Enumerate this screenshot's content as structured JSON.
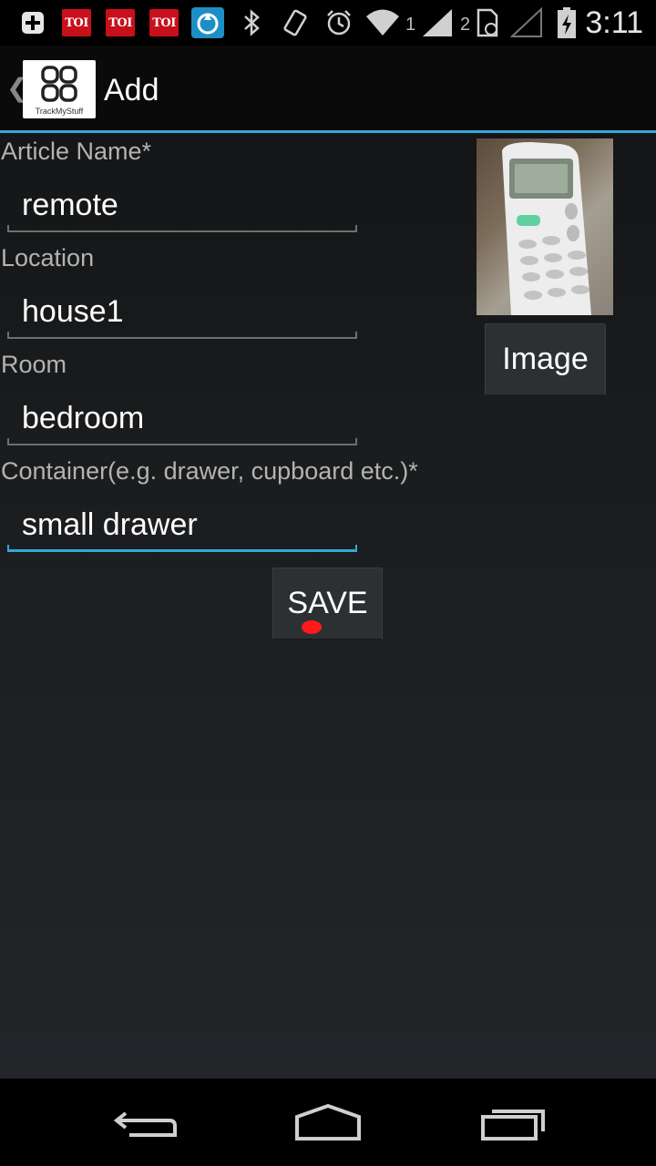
{
  "status_bar": {
    "notification_badges": [
      "TOI",
      "TOI",
      "TOI"
    ],
    "sim1_label": "1",
    "sim2_label": "2",
    "time": "3:11"
  },
  "action_bar": {
    "logo_caption": "TrackMyStuff",
    "title": "Add"
  },
  "form": {
    "article_name": {
      "label": "Article Name*",
      "value": "remote"
    },
    "location": {
      "label": "Location",
      "value": "house1"
    },
    "room": {
      "label": "Room",
      "value": "bedroom"
    },
    "container": {
      "label": "Container(e.g. drawer, cupboard etc.)*",
      "value": "small drawer"
    },
    "image_button_label": "Image",
    "save_button_label": "SAVE"
  },
  "colors": {
    "accent": "#33a8d8",
    "touch_indicator": "#ff1a1a"
  },
  "icons": {
    "status_left": [
      "plus-icon",
      "toi-icon",
      "toi-icon",
      "toi-icon",
      "water-drop-icon",
      "bluetooth-icon",
      "vibrate-icon",
      "alarm-icon"
    ],
    "status_right": [
      "wifi-icon",
      "signal-icon",
      "sim-icon",
      "no-signal-icon",
      "battery-icon"
    ],
    "nav": [
      "back-icon",
      "home-icon",
      "recents-icon"
    ]
  }
}
